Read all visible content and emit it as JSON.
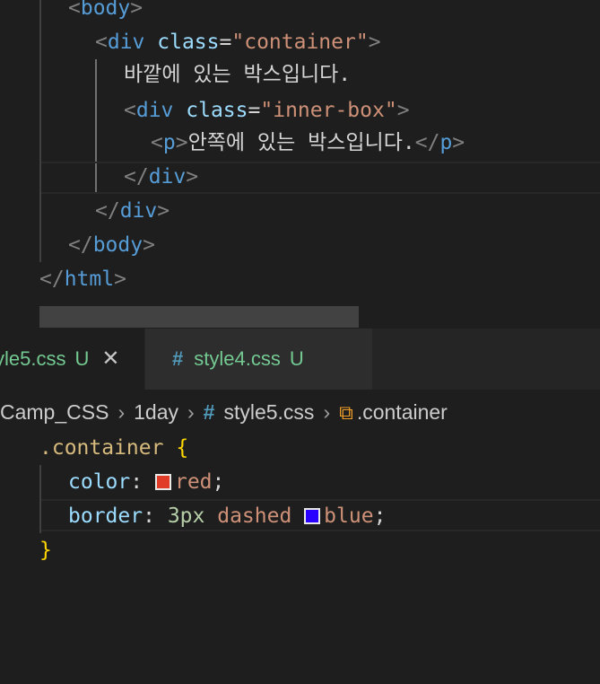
{
  "html_editor": {
    "lines": [
      {
        "open": "<",
        "tag": "body",
        "close": ">"
      },
      {
        "open": "<",
        "tag": "div",
        "attr": "class",
        "eq": "=",
        "str": "\"container\"",
        "close": ">"
      },
      {
        "text": "바깥에 있는 박스입니다."
      },
      {
        "open": "<",
        "tag": "div",
        "attr": "class",
        "eq": "=",
        "str": "\"inner-box\"",
        "close": ">"
      },
      {
        "open": "<",
        "tag": "p",
        "close": ">",
        "text": "안쪽에 있는 박스입니다.",
        "end_open": "</",
        "end_tag": "p",
        "end_close": ">"
      },
      {
        "open": "</",
        "tag": "div",
        "close": ">"
      },
      {
        "open": "</",
        "tag": "div",
        "close": ">"
      },
      {
        "open": "</",
        "tag": "body",
        "close": ">"
      },
      {
        "open": "</",
        "tag": "html",
        "close": ">"
      }
    ]
  },
  "tabs": [
    {
      "name": "yle5.css",
      "badge": "U",
      "close": "✕",
      "active": true
    },
    {
      "icon": "#",
      "name": "style4.css",
      "badge": "U",
      "active": false
    }
  ],
  "breadcrumb": {
    "items": [
      "Camp_CSS",
      "1day",
      "style5.css",
      ".container"
    ],
    "separator": "›",
    "file_icon": "#",
    "symbol_icon": "⧉"
  },
  "css_editor": {
    "selector": ".container",
    "open_brace": "{",
    "close_brace": "}",
    "rules": [
      {
        "property": "color",
        "colon": ":",
        "value": "red",
        "semi": ";",
        "swatch": "#e03c28"
      },
      {
        "property": "border",
        "colon": ":",
        "num": "3px",
        "kw": "dashed",
        "value": "blue",
        "semi": ";",
        "swatch": "#2a00ff"
      }
    ]
  },
  "colors": {
    "tag": "#569cd6",
    "attribute": "#9cdcfe",
    "string": "#ce9178",
    "selector": "#d7ba7d",
    "brace": "#ffd700",
    "number": "#b5cea8",
    "untracked": "#73c991"
  }
}
